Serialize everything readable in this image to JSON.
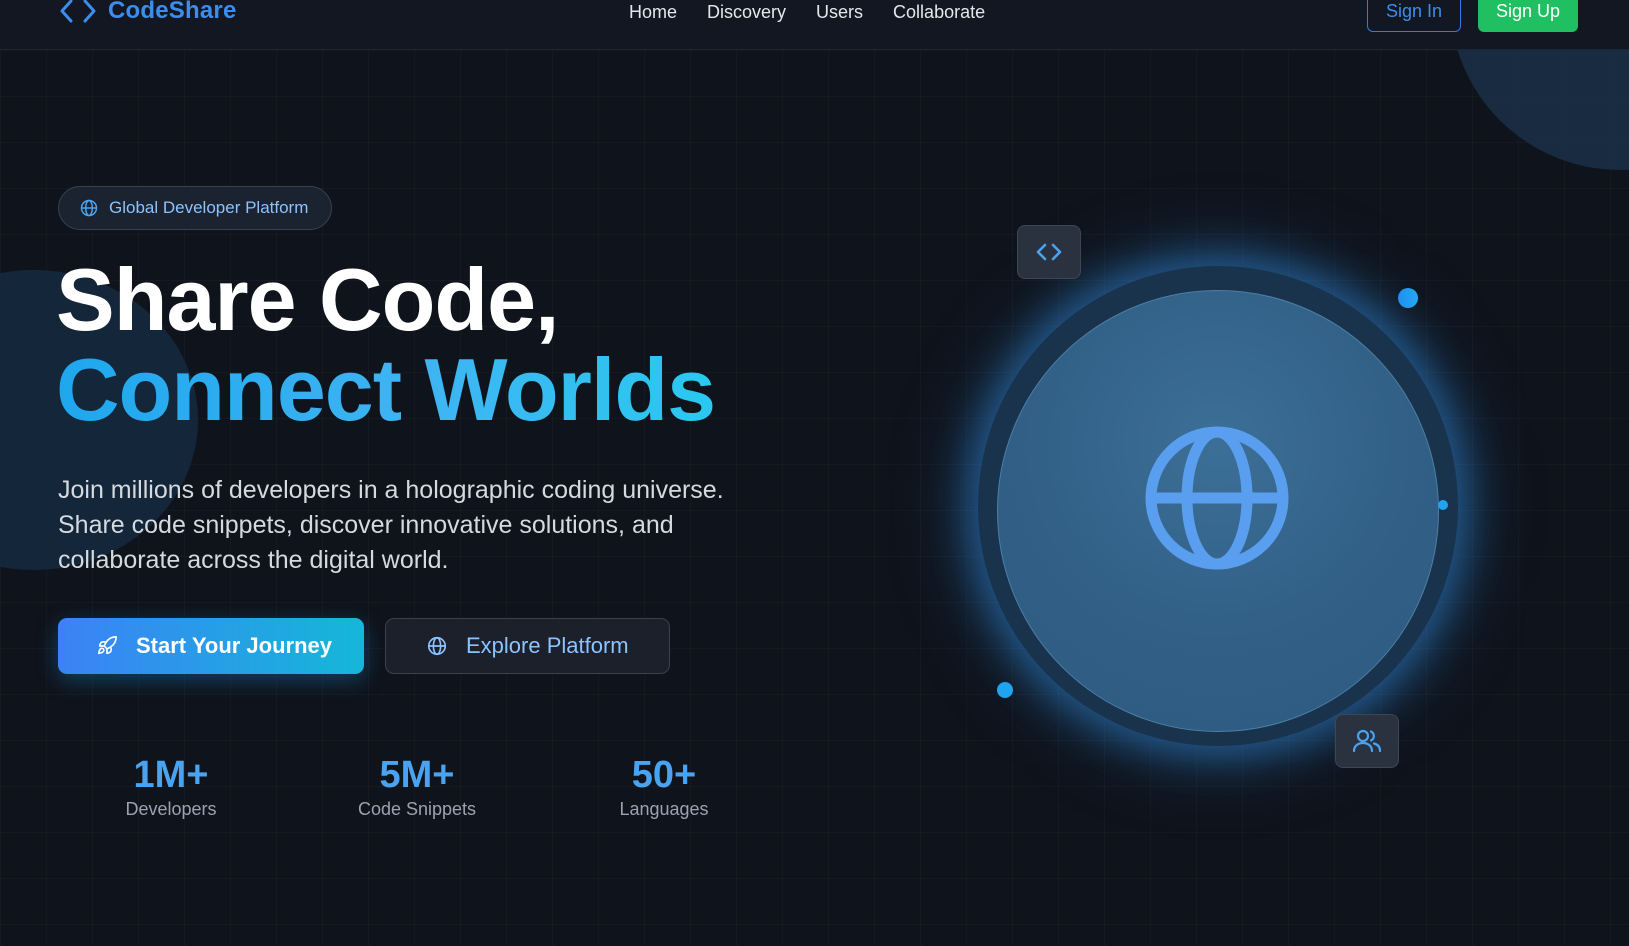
{
  "brand": {
    "name": "CodeShare",
    "accent": "#3b8ef0"
  },
  "nav": {
    "links": [
      "Home",
      "Discovery",
      "Users",
      "Collaborate"
    ],
    "sign_in": "Sign In",
    "sign_up": "Sign Up"
  },
  "hero": {
    "badge": {
      "icon": "globe-icon",
      "text": "Global Developer Platform"
    },
    "headline_line1": "Share Code,",
    "headline_line2": "Connect Worlds",
    "subtitle": "Join millions of developers in a holographic coding universe. Share code snippets, discover innovative solutions, and collaborate across the digital world.",
    "primary_button": {
      "icon": "rocket-icon",
      "label": "Start Your Journey"
    },
    "secondary_button": {
      "icon": "globe-icon",
      "label": "Explore Platform"
    }
  },
  "stats": [
    {
      "value": "1M+",
      "label": "Developers"
    },
    {
      "value": "5M+",
      "label": "Code Snippets"
    },
    {
      "value": "50+",
      "label": "Languages"
    }
  ],
  "visual": {
    "center_icon": "globe-icon",
    "floating_icons": [
      "code-icon",
      "users-icon"
    ]
  },
  "colors": {
    "background": "#0f131b",
    "primary_gradient_start": "#3b82f6",
    "primary_gradient_end": "#15b7d8",
    "signup_green": "#1fbf62",
    "stat_blue": "#4aa3f0"
  }
}
